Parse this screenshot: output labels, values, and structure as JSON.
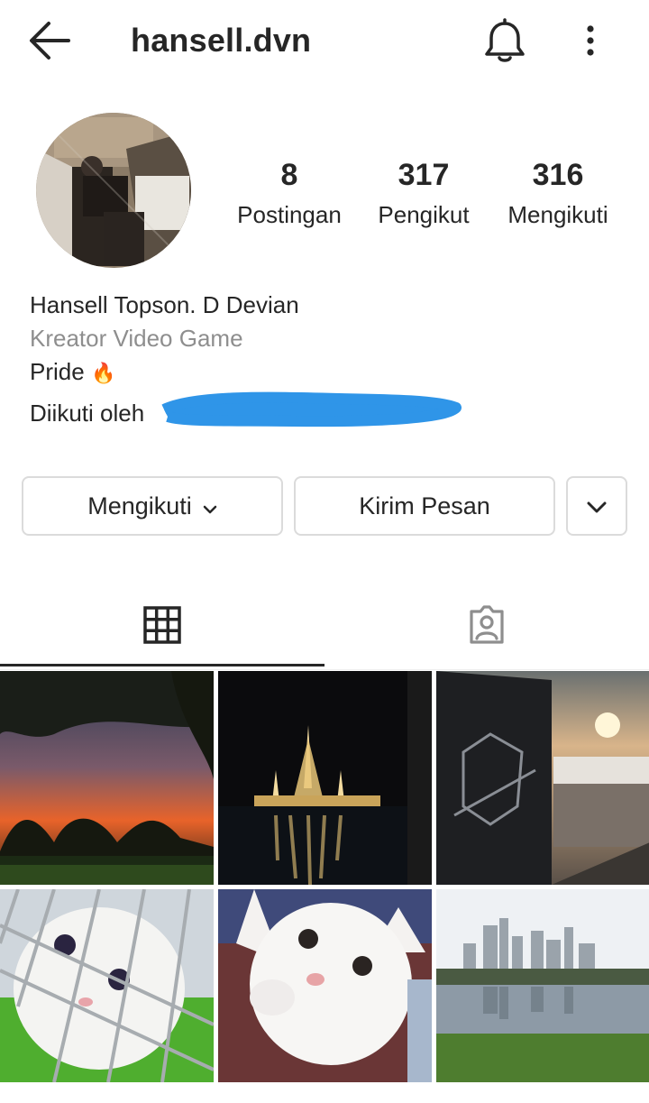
{
  "header": {
    "username": "hansell.dvn",
    "back_icon": "arrow-left-icon",
    "bell_icon": "bell-icon",
    "more_icon": "vertical-dots-icon"
  },
  "profile": {
    "stats": [
      {
        "value": "8",
        "label": "Postingan"
      },
      {
        "value": "317",
        "label": "Pengikut"
      },
      {
        "value": "316",
        "label": "Mengikuti"
      }
    ],
    "name": "Hansell Topson. D Devian",
    "category": "Kreator Video Game",
    "bio": "Pride",
    "bio_emoji": "🔥",
    "followed_by": "Diikuti oleh"
  },
  "actions": {
    "follow_label": "Mengikuti",
    "message_label": "Kirim Pesan"
  },
  "tabs": {
    "grid_icon": "grid-icon",
    "tagged_icon": "tagged-person-icon",
    "active": "grid"
  },
  "colors": {
    "text": "#262626",
    "secondary": "#8e8e8e",
    "border": "#dbdbdb",
    "scribble": "#2f95e8"
  }
}
